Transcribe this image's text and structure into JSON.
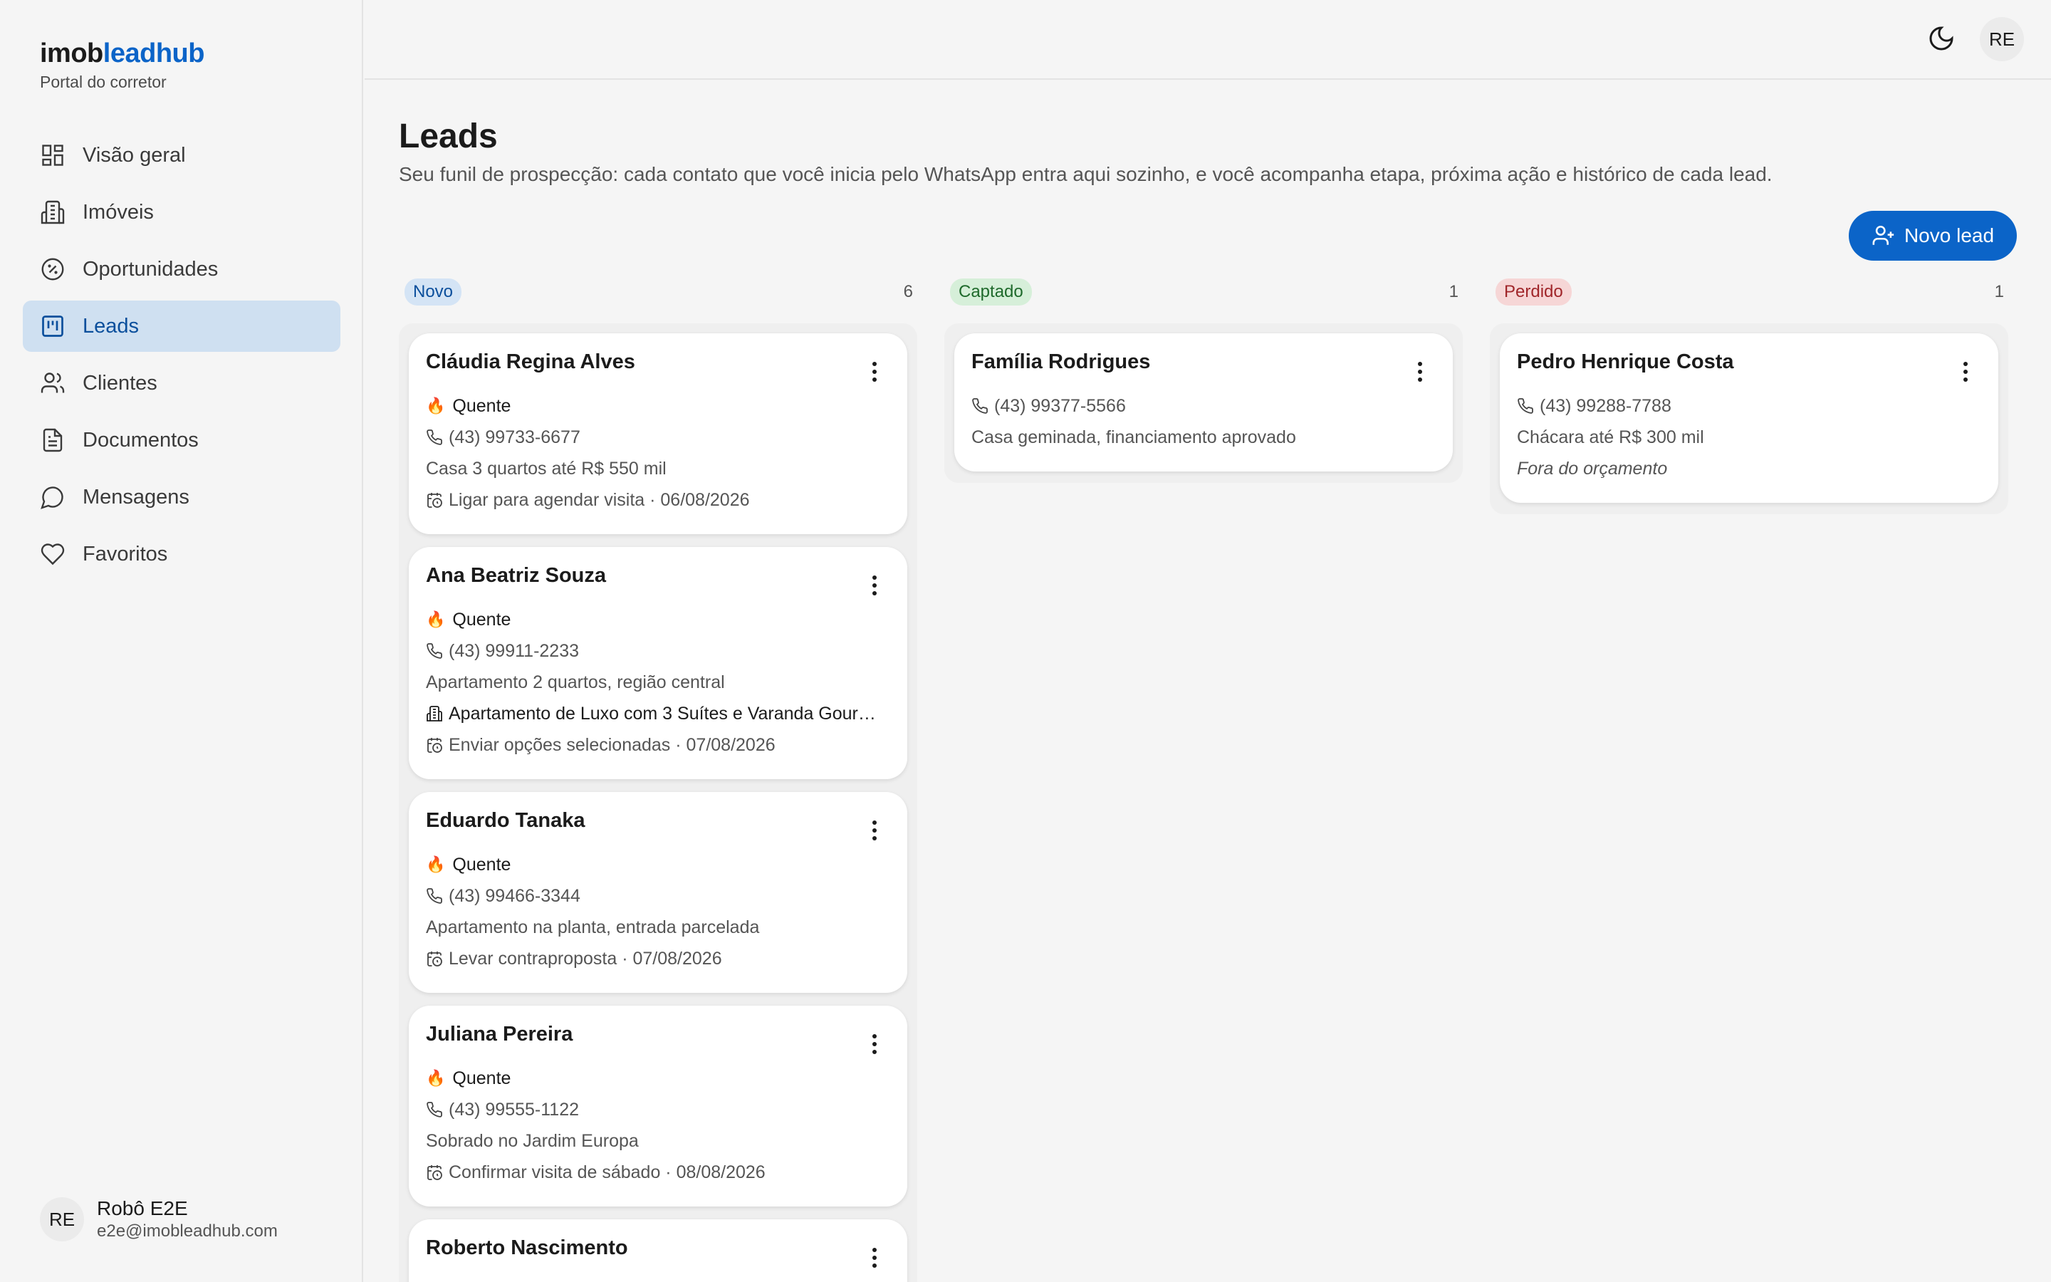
{
  "brand": {
    "name_a": "imob",
    "name_b": "leadhub",
    "subtitle": "Portal do corretor"
  },
  "sidebar": {
    "items": [
      {
        "label": "Visão geral",
        "icon": "dashboard-icon"
      },
      {
        "label": "Imóveis",
        "icon": "building-icon"
      },
      {
        "label": "Oportunidades",
        "icon": "badge-percent-icon"
      },
      {
        "label": "Leads",
        "icon": "kanban-icon",
        "active": true
      },
      {
        "label": "Clientes",
        "icon": "users-icon"
      },
      {
        "label": "Documentos",
        "icon": "document-icon"
      },
      {
        "label": "Mensagens",
        "icon": "message-icon"
      },
      {
        "label": "Favoritos",
        "icon": "heart-icon"
      }
    ]
  },
  "user": {
    "initials": "RE",
    "name": "Robô E2E",
    "email": "e2e@imobleadhub.com"
  },
  "topbar": {
    "initials": "RE",
    "theme_icon": "moon-icon"
  },
  "page": {
    "title": "Leads",
    "description": "Seu funil de prospecção: cada contato que você inicia pelo WhatsApp entra aqui sozinho, e você acompanha etapa, próxima ação e histórico de cada lead.",
    "new_button": "Novo lead"
  },
  "colors": {
    "accent": "#0b64c8",
    "active_bg": "#cfe0f1"
  },
  "columns": [
    {
      "label": "Novo",
      "count": "6",
      "cards": [
        {
          "name": "Cláudia Regina Alves",
          "temp": "Quente",
          "phone": "(43) 99733-6677",
          "interest": "Casa 3 quartos até R$ 550 mil",
          "action": "Ligar para agendar visita · 06/08/2026"
        },
        {
          "name": "Ana Beatriz Souza",
          "temp": "Quente",
          "phone": "(43) 99911-2233",
          "interest": "Apartamento 2 quartos, região central",
          "property": "Apartamento de Luxo com 3 Suítes e Varanda Gourmet ...",
          "action": "Enviar opções selecionadas · 07/08/2026"
        },
        {
          "name": "Eduardo Tanaka",
          "temp": "Quente",
          "phone": "(43) 99466-3344",
          "interest": "Apartamento na planta, entrada parcelada",
          "action": "Levar contraproposta · 07/08/2026"
        },
        {
          "name": "Juliana Pereira",
          "temp": "Quente",
          "phone": "(43) 99555-1122",
          "interest": "Sobrado no Jardim Europa",
          "action": "Confirmar visita de sábado · 08/08/2026"
        },
        {
          "name": "Roberto Nascimento"
        }
      ]
    },
    {
      "label": "Captado",
      "count": "1",
      "cards": [
        {
          "name": "Família Rodrigues",
          "phone": "(43) 99377-5566",
          "interest": "Casa geminada, financiamento aprovado"
        }
      ]
    },
    {
      "label": "Perdido",
      "count": "1",
      "cards": [
        {
          "name": "Pedro Henrique Costa",
          "phone": "(43) 99288-7788",
          "interest": "Chácara até R$ 300 mil",
          "reason": "Fora do orçamento"
        }
      ]
    }
  ]
}
